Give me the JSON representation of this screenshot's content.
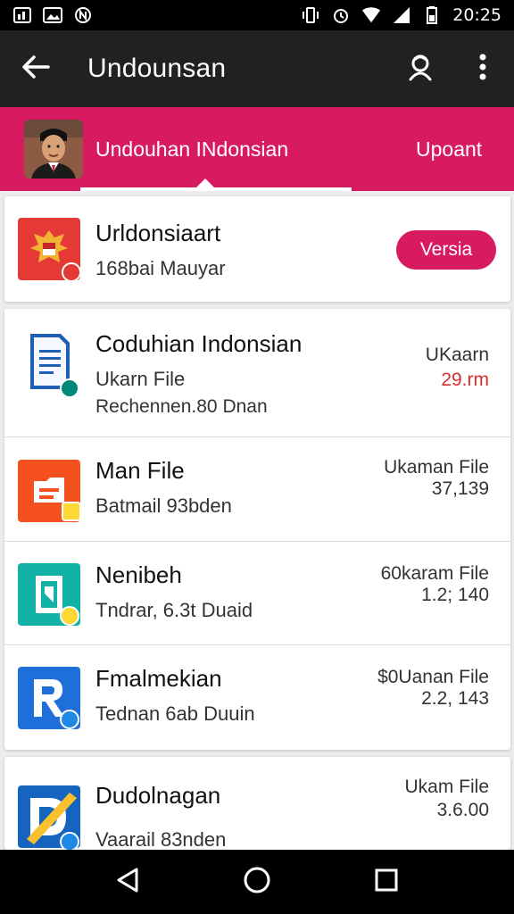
{
  "status_bar": {
    "time": "20:25",
    "left_icons": [
      "image-icon",
      "photo-icon",
      "n-icon"
    ],
    "right_icons": [
      "vibrate-icon",
      "alarm-icon",
      "wifi-icon",
      "signal-icon",
      "battery-icon"
    ]
  },
  "app_bar": {
    "title": "Undounsan",
    "back_icon": "arrow-back-icon",
    "action_icons": [
      "account-icon",
      "more-vert-icon"
    ]
  },
  "tabs": {
    "main_label": "Undouhan INdonsian",
    "right_label": "Upoant",
    "accent_color": "#d81b60"
  },
  "featured": {
    "title": "Urldonsiaart",
    "subtitle": "168bai Mauyar",
    "button_label": "Versia"
  },
  "files": [
    {
      "title": "Coduhian Indonsian",
      "subtitle": "Ukarn File",
      "detail": "Rechennen.80 Dnan",
      "meta1": "UKaarn",
      "meta2": "29.rm",
      "meta2_color": "#d32f2f",
      "icon": "document-icon"
    },
    {
      "title": "Man File",
      "subtitle": "Batmail 93bden",
      "meta1": "Ukaman File",
      "meta2": "37,139",
      "icon": "folder-icon"
    },
    {
      "title": "Nenibeh",
      "subtitle": "Tndrar, 6.3t Duaid",
      "meta1": "60karam File",
      "meta2": "1.2; 140",
      "icon": "map-icon"
    },
    {
      "title": "Fmalmekian",
      "subtitle": "Tednan 6ab Duuin",
      "meta1": "$0Uanan File",
      "meta2": "2.2, 143",
      "icon": "r-app-icon"
    },
    {
      "title": "Dudolnagan",
      "subtitle": "Vaarail 83nden",
      "meta1": "Ukam File",
      "meta2": "3.6.00",
      "icon": "edit-app-icon"
    }
  ],
  "nav": {
    "icons": [
      "back-triangle-icon",
      "home-circle-icon",
      "recents-square-icon"
    ]
  }
}
